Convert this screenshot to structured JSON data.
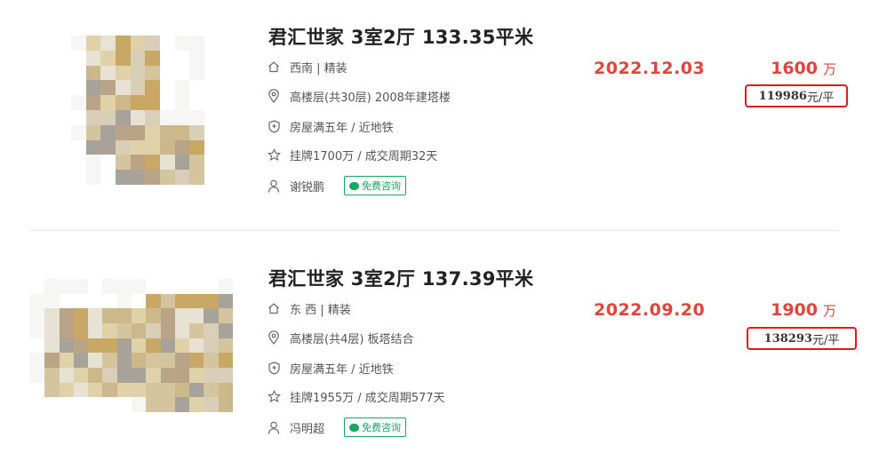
{
  "listings": [
    {
      "title": "君汇世家 3室2厅 133.35平米",
      "orientation_decor": "西南 | 精装",
      "floor_info": "高楼层(共30层) 2008年建塔楼",
      "tags": "房屋满五年 / 近地铁",
      "listing_info": "挂牌1700万 / 成交周期32天",
      "agent": "谢锐鹏",
      "consult_label": "免费咨询",
      "deal_date": "2022.12.03",
      "total_price": "1600",
      "price_unit": "万",
      "unit_price_num": "119986",
      "unit_price_unit": "元/平"
    },
    {
      "title": "君汇世家 3室2厅 137.39平米",
      "orientation_decor": "东 西 | 精装",
      "floor_info": "高楼层(共4层) 板塔结合",
      "tags": "房屋满五年 / 近地铁",
      "listing_info": "挂牌1955万 / 成交周期577天",
      "agent": "冯明超",
      "consult_label": "免费咨询",
      "deal_date": "2022.09.20",
      "total_price": "1900",
      "price_unit": "万",
      "unit_price_num": "138293",
      "unit_price_unit": "元/平"
    }
  ],
  "colors": {
    "accent_red": "#e0443a",
    "highlight_box": "#e01c1c",
    "consult_green": "#1aa760"
  },
  "icons": [
    "home-icon",
    "location-pin-icon",
    "shield-icon",
    "star-icon",
    "user-icon",
    "chat-bubble-icon"
  ]
}
